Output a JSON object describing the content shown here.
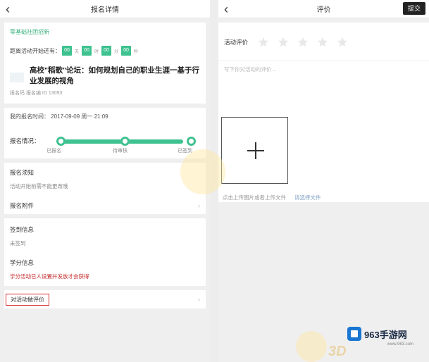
{
  "left": {
    "header": {
      "back_icon": "chevron-left-icon",
      "title": "报名详情"
    },
    "top_card": {
      "tag": "零基础社团招新",
      "countdown_label": "距离活动开始还有：",
      "countdown": [
        "00",
        "00",
        "00",
        "00"
      ],
      "countdown_units": [
        "天",
        "时",
        "分",
        "秒"
      ],
      "title": "高校\"稻歌\"论坛：如何规划自己的职业生涯一基于行业发展的视角",
      "meta": "报名码  报名编  ID  13093"
    },
    "register_time": "我的报名时间：  2017-09-09 周一 21:09",
    "progress": {
      "label": "报名情况：",
      "steps": [
        "已报名",
        "待审核",
        "已签到"
      ]
    },
    "sections": [
      {
        "head": "报名须知",
        "body": "活动开始前需不能更改哦"
      },
      {
        "head": "报名附件",
        "body": ""
      }
    ],
    "sign_info": {
      "head": "签到信息",
      "body": "未签到"
    },
    "credit_info": {
      "head": "学分信息",
      "body": "学分活动已人设置并发放才会获得"
    },
    "evaluate_entry": "对活动做评价"
  },
  "right": {
    "header": {
      "back_icon": "chevron-left-icon",
      "title": "评价",
      "submit_label": "提交"
    },
    "rating_label": "活动评价",
    "stars": 5,
    "textarea_placeholder": "写下你对活动的评价…",
    "upload_hint": "点击上传图片或者上传文件",
    "upload_link": "请选择文件"
  },
  "watermark": {
    "brand": "963手游网",
    "url": "www.963.com",
    "mark": "3D"
  }
}
